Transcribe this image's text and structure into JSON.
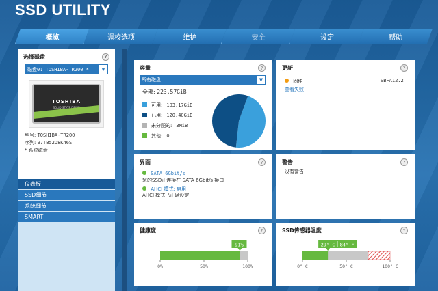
{
  "app": {
    "title": "SSD UTILITY"
  },
  "tabs": [
    {
      "label": "概览",
      "state": "active"
    },
    {
      "label": "调校选项",
      "state": "normal"
    },
    {
      "label": "维护",
      "state": "normal"
    },
    {
      "label": "安全",
      "state": "disabled"
    },
    {
      "label": "设定",
      "state": "normal"
    },
    {
      "label": "帮助",
      "state": "normal"
    }
  ],
  "sidebar": {
    "select_label": "选择磁盘",
    "selected_disk": "磁盘0: TOSHIBA-TR200 *",
    "ssd_brand": "TOSHIBA",
    "ssd_sub": "SOLID STATE DRIVE",
    "model_label": "型号:",
    "model_value": "TOSHIBA-TR200",
    "serial_label": "序列:",
    "serial_value": "97TB52D8K46S",
    "system_disk": "* 系统磁盘",
    "nav_head": "仪表板",
    "nav_items": [
      "SSD细节",
      "系统细节",
      "SMART"
    ]
  },
  "capacity": {
    "title": "容量",
    "dropdown_value": "所有磁盘",
    "total_label": "全部:",
    "total_value": "223.57GiB",
    "legend": [
      {
        "label": "可用:",
        "value": "103.17GiB",
        "color": "#3aa0dc"
      },
      {
        "label": "已用:",
        "value": "120.40GiB",
        "color": "#0d4f85"
      },
      {
        "label": "未分配的:",
        "value": "3MiB",
        "color": "#b4b4b4"
      },
      {
        "label": "其他:",
        "value": "0",
        "color": "#66b93f"
      }
    ],
    "pie_values": [
      103.17,
      120.4
    ]
  },
  "update": {
    "title": "更新",
    "firmware_label": "固件",
    "firmware_value": "SBFA12.2",
    "check_failed": "查看失败",
    "dot_color": "#f39c12"
  },
  "interface": {
    "title": "界面",
    "sata_label": "SATA 6Gbit/s",
    "sata_desc": "您的SSD正连接在 SATA 6Gbit/s 接口",
    "ahci_label": "AHCI 模式: 启用",
    "ahci_desc": "AHCI 模式已正确设定",
    "dot_color": "#66b93f"
  },
  "warning": {
    "title": "警告",
    "text": "没有警告"
  },
  "health": {
    "title": "健康度",
    "percent": 91,
    "badge": "91%",
    "ticks": [
      "0%",
      "50%",
      "100%"
    ]
  },
  "temperature": {
    "title": "SSD传感器温度",
    "value_c": 29,
    "badge_c": "29° C",
    "badge_f": "84° F",
    "ticks": [
      "0° C",
      "50° C",
      "100° C"
    ]
  },
  "colors": {
    "accent_blue": "#2a78bd",
    "health_green": "#66b93f",
    "danger_red": "#e05050"
  }
}
